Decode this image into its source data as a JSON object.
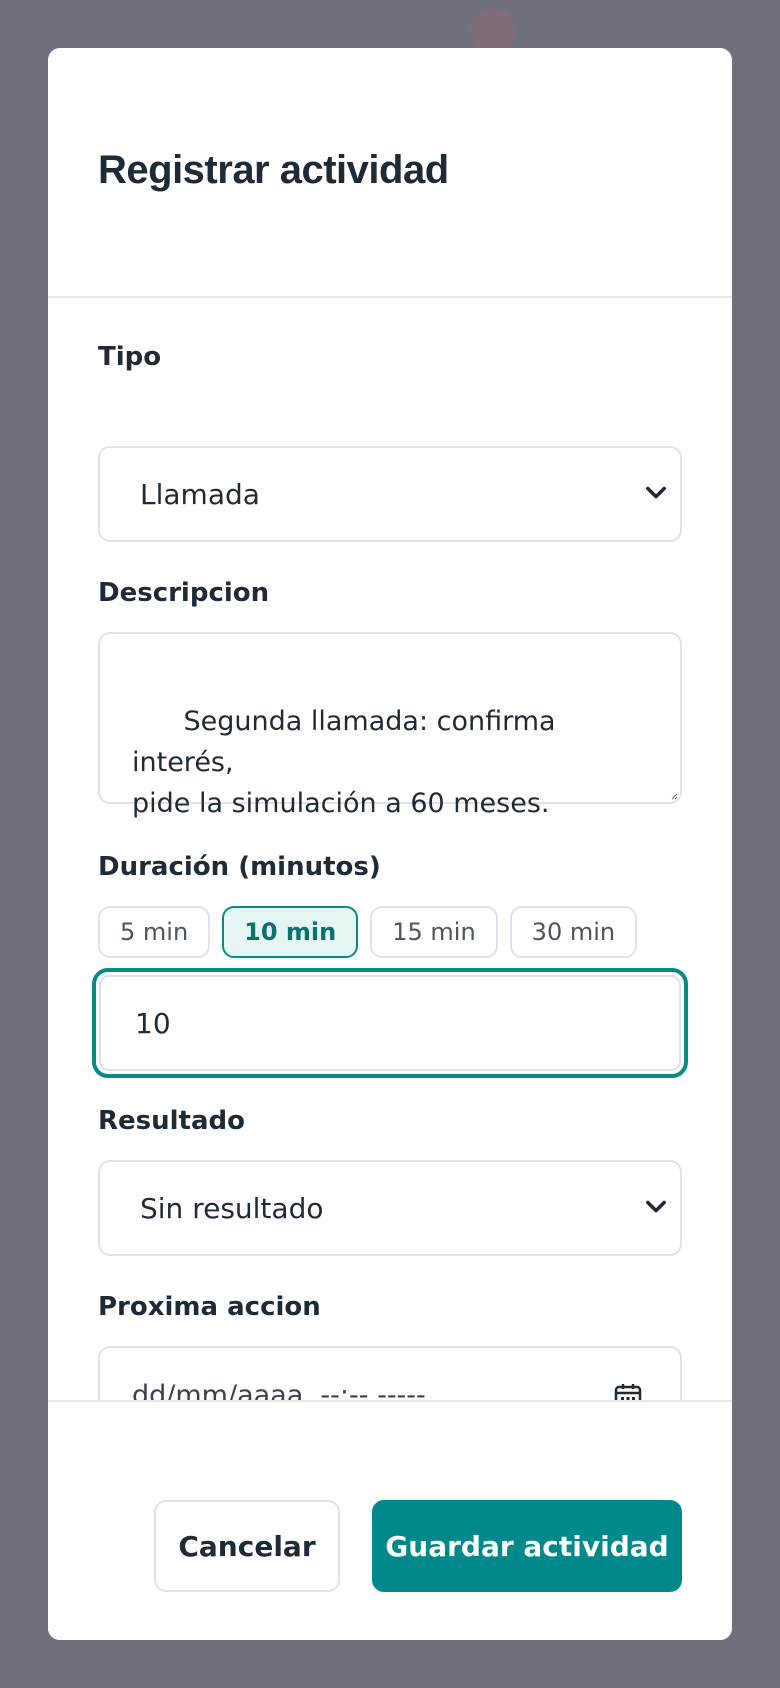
{
  "modal": {
    "title": "Registrar actividad"
  },
  "form": {
    "tipo": {
      "label": "Tipo",
      "value": "Llamada"
    },
    "descripcion": {
      "label": "Descripcion",
      "value": "Segunda llamada: confirma interés,\npide la simulación a 60 meses."
    },
    "duracion": {
      "label": "Duración (minutos)",
      "presets": [
        "5 min",
        "10 min",
        "15 min",
        "30 min"
      ],
      "active_preset": "10 min",
      "value": "10"
    },
    "resultado": {
      "label": "Resultado",
      "value": "Sin resultado"
    },
    "proxima_accion": {
      "label": "Proxima accion",
      "placeholder": "dd/mm/aaaa, --:-- -----"
    }
  },
  "footer": {
    "cancel_label": "Cancelar",
    "save_label": "Guardar actividad"
  },
  "colors": {
    "accent": "#00898a",
    "accent_soft": "#e5f5f4",
    "backdrop": "#6f717c",
    "text": "#1f2a37"
  }
}
